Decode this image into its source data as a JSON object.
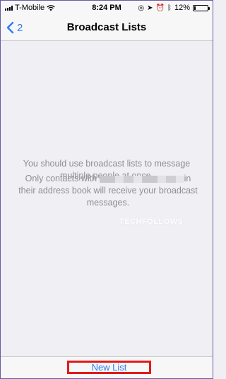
{
  "status_bar": {
    "carrier": "T-Mobile",
    "time": "8:24 PM",
    "battery": "12%",
    "battery_level": 0.12,
    "icons": [
      "signal-icon",
      "wifi-icon",
      "lock-rotation-icon",
      "location-icon",
      "alarm-icon",
      "bluetooth-icon",
      "battery-icon"
    ]
  },
  "nav": {
    "back_label": "2",
    "title": "Broadcast Lists"
  },
  "content": {
    "message_1": "You should use broadcast lists to message multiple people at once.",
    "message_2_before": "Only contacts with",
    "message_2_after": "in their address book will receive your broadcast messages.",
    "watermark": "TECHFOLLOWS"
  },
  "toolbar": {
    "new_list_label": "New List"
  },
  "colors": {
    "accent": "#2f7bf5",
    "highlight_box": "#e01b1b",
    "text_muted": "#8e8e93"
  }
}
